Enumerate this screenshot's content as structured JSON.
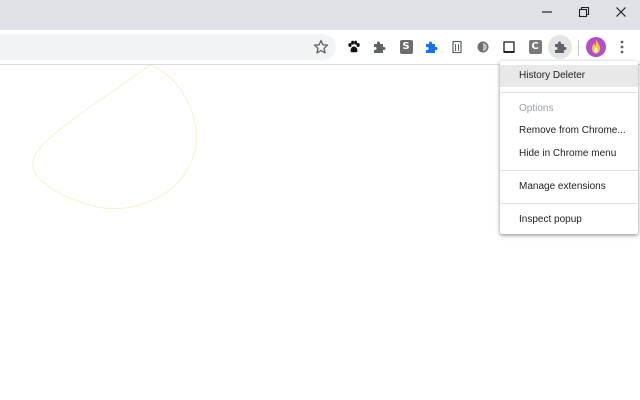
{
  "window": {
    "controls": {
      "minimize_icon": "minimize-icon",
      "restore_icon": "restore-icon",
      "close_icon": "close-icon"
    }
  },
  "toolbar": {
    "extensions": [
      {
        "icon": "paw-icon"
      },
      {
        "icon": "puzzle-gray-icon"
      },
      {
        "icon": "s-badge-icon",
        "letter": "S"
      },
      {
        "icon": "puzzle-blue-icon"
      },
      {
        "icon": "document-icon"
      },
      {
        "icon": "circle-icon"
      },
      {
        "icon": "square-outline-icon"
      },
      {
        "icon": "c-badge-icon",
        "letter": "C"
      },
      {
        "icon": "puzzle-active-icon"
      }
    ],
    "accent_blue": "#1a73e8",
    "avatar_color": "#b24fc8"
  },
  "menu": {
    "items": [
      {
        "label": "History Deleter",
        "highlighted": true
      },
      {
        "label": "Options",
        "disabled": true
      },
      {
        "label": "Remove from Chrome..."
      },
      {
        "label": "Hide in Chrome menu"
      },
      {
        "label": "Manage extensions"
      },
      {
        "label": "Inspect popup"
      }
    ]
  }
}
